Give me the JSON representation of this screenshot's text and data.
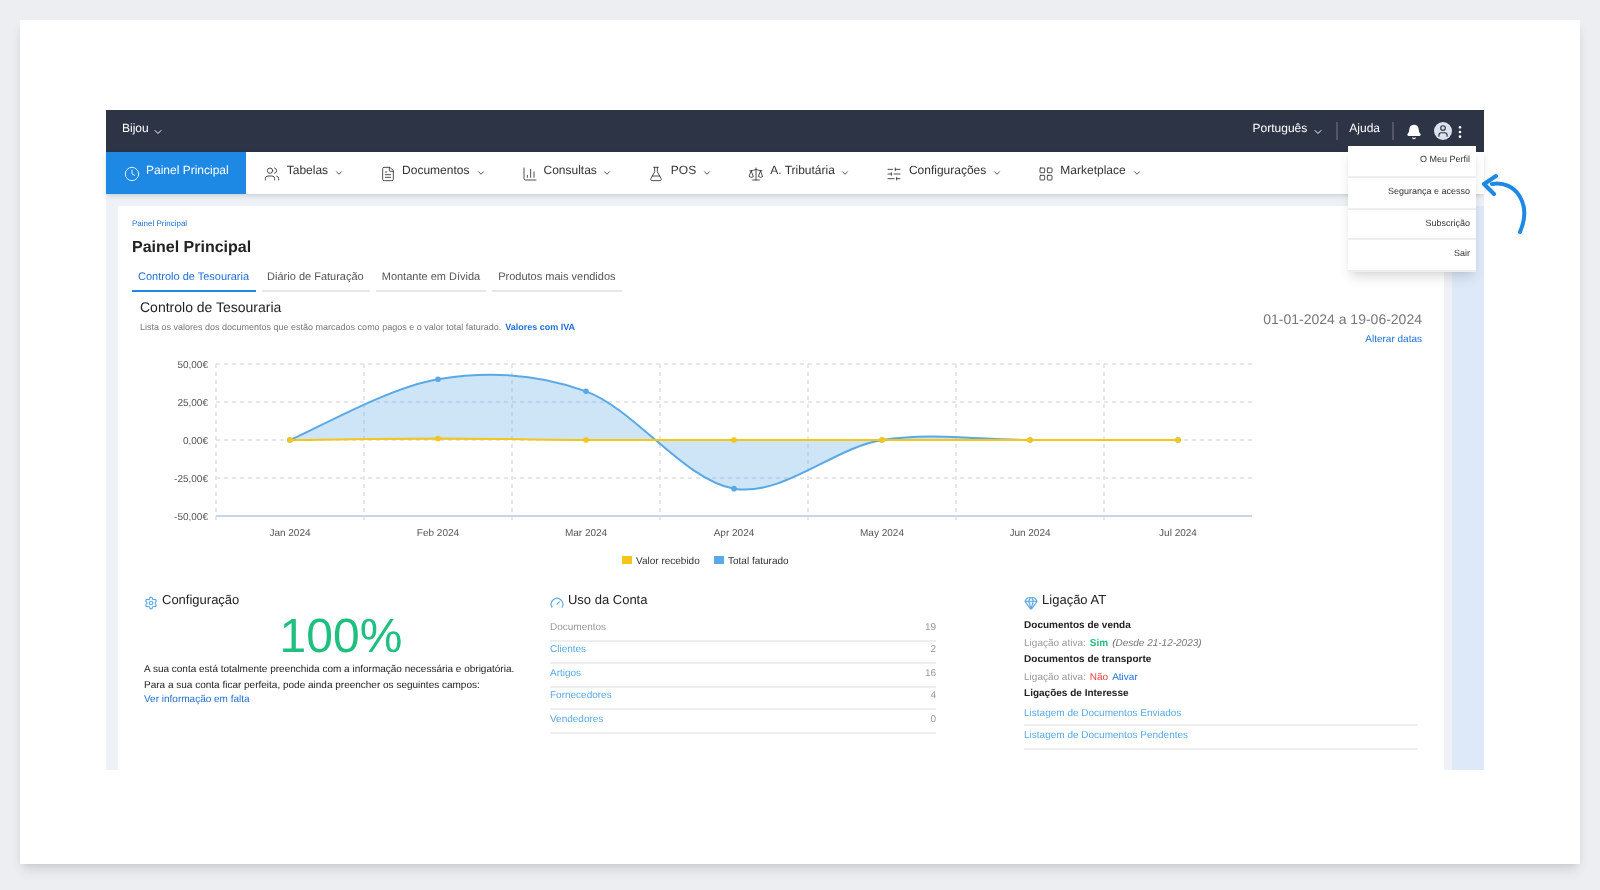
{
  "top_bar": {
    "company": "Bijou",
    "language": "Português",
    "help": "Ajuda"
  },
  "nav": [
    {
      "label": "Painel Principal",
      "selected": true,
      "dropdown": false
    },
    {
      "label": "Tabelas",
      "selected": false,
      "dropdown": true
    },
    {
      "label": "Documentos",
      "selected": false,
      "dropdown": true
    },
    {
      "label": "Consultas",
      "selected": false,
      "dropdown": true
    },
    {
      "label": "POS",
      "selected": false,
      "dropdown": true
    },
    {
      "label": "A. Tributária",
      "selected": false,
      "dropdown": true
    },
    {
      "label": "Configurações",
      "selected": false,
      "dropdown": true
    },
    {
      "label": "Marketplace",
      "selected": false,
      "dropdown": true
    }
  ],
  "profile_menu": [
    "O Meu Perfil",
    "Segurança e acesso",
    "Subscrição",
    "Sair"
  ],
  "breadcrumb": "Painel Principal",
  "title": "Painel Principal",
  "tabs": [
    {
      "label": "Controlo de Tesouraria",
      "selected": true
    },
    {
      "label": "Diário de Faturação",
      "selected": false
    },
    {
      "label": "Montante em Dívida",
      "selected": false
    },
    {
      "label": "Produtos mais vendidos",
      "selected": false
    }
  ],
  "section": {
    "title": "Controlo de Tesouraria",
    "description": "Lista os valores dos documentos que estão marcados como pagos e o valor total faturado.",
    "description_link": "Valores com IVA",
    "date_range": "01-01-2024 a 19-06-2024",
    "change_dates": "Alterar datas",
    "chart_data": {
      "type": "area",
      "categories": [
        "Jan 2024",
        "Feb 2024",
        "Mar 2024",
        "Apr 2024",
        "May 2024",
        "Jun 2024",
        "Jul 2024"
      ],
      "grid": true,
      "legend": "bottom",
      "series": [
        {
          "name": "Valor recebido",
          "color": "#f5c518",
          "values": [
            0,
            1,
            0,
            0,
            0,
            0,
            0
          ]
        },
        {
          "name": "Total faturado",
          "color": "#5aa9e6",
          "values": [
            0,
            40,
            32,
            -32,
            0,
            0,
            0
          ]
        }
      ],
      "ylim": [
        -50,
        50
      ],
      "yticks": [
        {
          "value": 50,
          "label": "50,00€"
        },
        {
          "value": 25,
          "label": "25,00€"
        },
        {
          "value": 0,
          "label": "0,00€"
        },
        {
          "value": -25,
          "label": "-25,00€"
        },
        {
          "value": -50,
          "label": "-50,00€"
        }
      ]
    }
  },
  "configuration": {
    "title": "Configuração",
    "percent": "100%",
    "text": "A sua conta está totalmente preenchida com a informação necessária e obrigatória.",
    "text2": "Para a sua conta ficar perfeita, pode ainda preencher os seguintes campos:",
    "link": "Ver informação em falta"
  },
  "usage": {
    "title": "Uso da Conta",
    "rows": [
      {
        "name": "Documentos",
        "count": "19",
        "disabled": true
      },
      {
        "name": "Clientes",
        "count": "2",
        "disabled": false
      },
      {
        "name": "Artigos",
        "count": "16",
        "disabled": false
      },
      {
        "name": "Fornecedores",
        "count": "4",
        "disabled": false
      },
      {
        "name": "Vendedores",
        "count": "0",
        "disabled": false
      }
    ]
  },
  "at": {
    "title": "Ligação AT",
    "connections": [
      {
        "heading": "Documentos de venda",
        "label": "Ligação ativa:",
        "status": "Sim",
        "active": true,
        "note": "(Desde 21-12-2023)"
      },
      {
        "heading": "Documentos de transporte",
        "label": "Ligação ativa:",
        "status": "Não",
        "active": false,
        "action": "Ativar"
      }
    ],
    "links_title": "Ligações de Interesse",
    "links": [
      "Listagem de Documentos Enviados",
      "Listagem de Documentos Pendentes"
    ]
  }
}
